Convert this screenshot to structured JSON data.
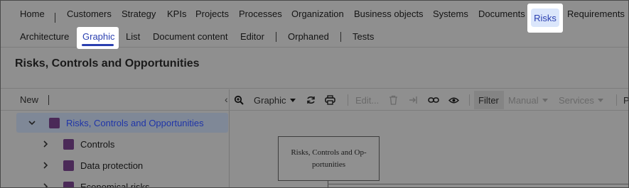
{
  "nav_primary": {
    "items": [
      "Home",
      "Customers",
      "Strategy",
      "KPIs",
      "Projects",
      "Processes",
      "Organization",
      "Business objects",
      "Systems",
      "Documents",
      "Risks",
      "Requirements"
    ],
    "active": "Risks"
  },
  "nav_secondary": {
    "items": [
      "Architecture",
      "Graphic",
      "List",
      "Document content",
      "Editor",
      "Orphaned",
      "Tests"
    ],
    "active": "Graphic"
  },
  "page": {
    "title": "Risks, Controls and Opportunities"
  },
  "left_panel": {
    "new_label": "New",
    "collapse_glyph": "‹",
    "tree": [
      {
        "label": "Risks, Controls and Opportunities",
        "expanded": true,
        "selected": true
      },
      {
        "label": "Controls",
        "expanded": false,
        "selected": false
      },
      {
        "label": "Data protection",
        "expanded": false,
        "selected": false
      },
      {
        "label": "Economical risks",
        "expanded": false,
        "selected": false
      }
    ]
  },
  "toolbar": {
    "view_label": "Graphic",
    "edit_label": "Edit...",
    "filter_label": "Filter",
    "manual_label": "Manual",
    "services_label": "Services",
    "truncated_label": "P"
  },
  "canvas": {
    "node_text": "Risks, Controls and Op-portunities",
    "node_line1": "Risks, Controls and Op-",
    "node_line2": "portunities"
  },
  "colors": {
    "accent": "#2a3fb0",
    "risks_pill": "#dbe6fb",
    "tree_square": "#4b2a58"
  }
}
